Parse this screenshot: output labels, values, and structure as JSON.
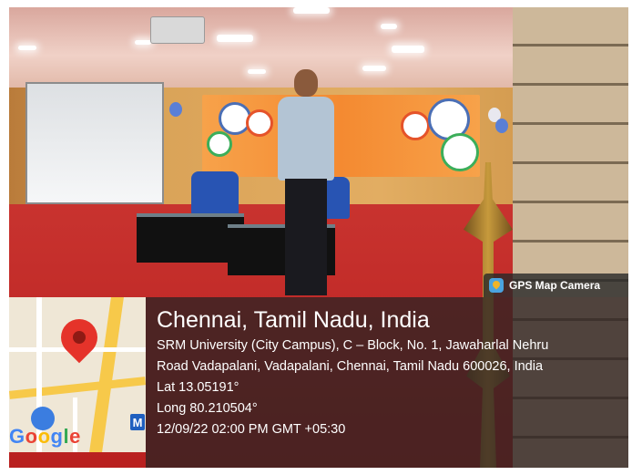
{
  "gps_tag": {
    "label": "GPS Map Camera",
    "icon": "gps-map-camera-icon"
  },
  "location": {
    "city": "Chennai, Tamil Nadu, India",
    "address_line1": "SRM University (City Campus), C – Block, No. 1, Jawaharlal Nehru",
    "address_line2": "Road Vadapalani, Vadapalani, Chennai, Tamil Nadu 600026, India",
    "lat": "Lat 13.05191°",
    "long": "Long 80.210504°",
    "datetime": "12/09/22 02:00 PM GMT +05:30"
  },
  "map": {
    "pin_icon": "map-pin-icon",
    "metro_label": "M",
    "logo": "Google",
    "colors": {
      "pin": "#e5332a",
      "road": "#f7c94a",
      "metro": "#1f5fbf"
    }
  }
}
